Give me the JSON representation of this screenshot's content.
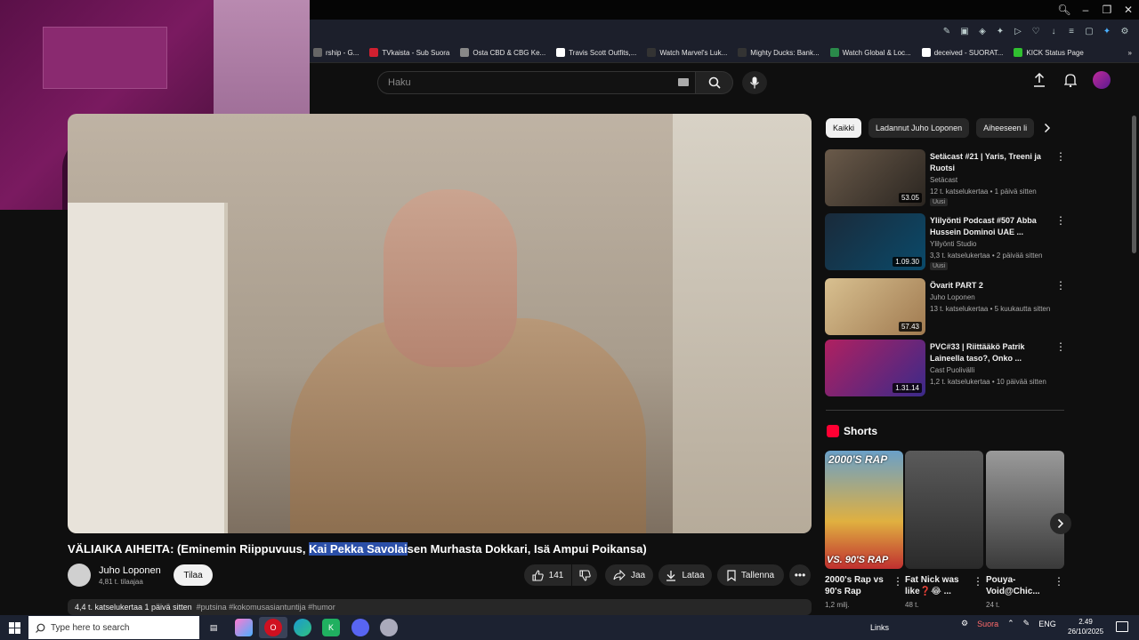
{
  "colors": {
    "bg": "#0f0f0f",
    "accent": "#ff0033",
    "highlight": "#2b4fa8",
    "taskbar": "#1c2231"
  },
  "bookmarks": [
    {
      "label": "rship - G...",
      "icon": "bookmark-icon"
    },
    {
      "label": "TVkaista - Sub Suora",
      "icon": "tv-icon"
    },
    {
      "label": "Osta CBD & CBG Ke...",
      "icon": "leaf-icon"
    },
    {
      "label": "Travis Scott Outfits,...",
      "icon": "page-icon"
    },
    {
      "label": "Watch Marvel's Luk...",
      "icon": "stream-icon"
    },
    {
      "label": "Mighty Ducks: Bank...",
      "icon": "stream-icon"
    },
    {
      "label": "Watch Global & Loc...",
      "icon": "globe-icon"
    },
    {
      "label": "deceived - SUORAT...",
      "icon": "page-icon"
    },
    {
      "label": "KICK Status Page",
      "icon": "kick-icon"
    }
  ],
  "search": {
    "placeholder": "Haku"
  },
  "video": {
    "title_before": "VÄLIAIKA AIHEITA: (Eminemin Riippuvuus, ",
    "title_selected": "Kai Pekka Savolai",
    "title_after": "sen Murhasta Dokkari, Isä Ampui Poikansa)",
    "channel": "Juho Loponen",
    "subscribers": "4,81 t. tilaajaa",
    "subscribe_label": "Tilaa",
    "likes": "141",
    "share_label": "Jaa",
    "download_label": "Lataa",
    "save_label": "Tallenna",
    "description_meta": "4,4 t. katselukertaa  1 päivä sitten",
    "description_tags": "#putsina #kokomusasiantuntija #humor"
  },
  "chips": [
    "Kaikki",
    "Ladannut Juho Loponen",
    "Aiheeseen li"
  ],
  "recommendations": [
    {
      "title": "Setäcast #21 | Yaris, Treeni ja Ruotsi",
      "channel": "Setäcast",
      "meta": "12 t. katselukertaa • 1 päivä sitten",
      "badge": "Uusi",
      "duration": "53.05"
    },
    {
      "title": "Ylilyönti Podcast #507 Abba Hussein Dominoi UAE ...",
      "channel": "Ylilyönti Studio",
      "meta": "3,3 t. katselukertaa • 2 päivää sitten",
      "badge": "Uusi",
      "duration": "1.09.30"
    },
    {
      "title": "Övarit PART 2",
      "channel": "Juho Loponen",
      "meta": "13 t. katselukertaa • 5 kuukautta sitten",
      "badge": "",
      "duration": "57.43"
    },
    {
      "title": "PVC#33 | Riittääkö Patrik Laineella taso?, Onko ...",
      "channel": "Cast Puolivälli",
      "meta": "1,2 t. katselukertaa • 10 päivää sitten",
      "badge": "",
      "duration": "1.31.14"
    }
  ],
  "shorts": {
    "heading": "Shorts",
    "items": [
      {
        "title": "2000's Rap vs 90's Rap",
        "views": "1,2 milj.",
        "thumb_top": "2000'S RAP",
        "thumb_bottom": "VS. 90'S RAP"
      },
      {
        "title": "Fat Nick was like❓😂 ...",
        "views": "48 t.",
        "thumb_top": "",
        "thumb_bottom": ""
      },
      {
        "title": "Pouya- Void@Chic...",
        "views": "24 t.",
        "thumb_top": "",
        "thumb_bottom": ""
      }
    ]
  },
  "taskbar": {
    "search_placeholder": "Type here to search",
    "links_label": "Links",
    "live_label": "Suora",
    "language": "ENG",
    "time": "2.49",
    "date": "26/10/2025"
  }
}
